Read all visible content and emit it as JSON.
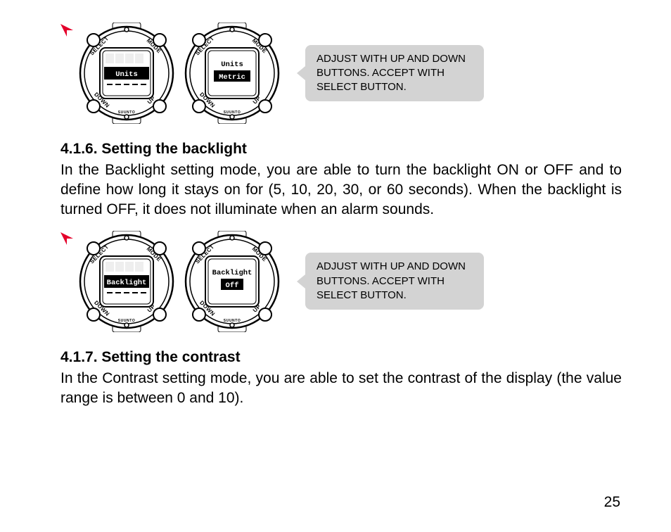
{
  "watch": {
    "buttons": {
      "tl": "SELECT",
      "tr": "MODE",
      "bl": "DOWN",
      "br": "UP"
    },
    "brand": "SUUNTO"
  },
  "figures": {
    "units": {
      "watch1": {
        "line1": "Units"
      },
      "watch2": {
        "line1": "Units",
        "line2": "Metric"
      },
      "callout": "ADJUST WITH UP AND DOWN BUTTONS. ACCEPT WITH SELECT BUTTON."
    },
    "backlight": {
      "watch1": {
        "line1": "Backlight"
      },
      "watch2": {
        "line1": "Backlight",
        "line2": "Off"
      },
      "callout": "ADJUST WITH UP AND DOWN BUTTONS. ACCEPT WITH SELECT BUTTON."
    }
  },
  "sections": {
    "s416": {
      "heading": "4.1.6. Setting the backlight",
      "body": "In the Backlight setting mode, you are able to turn the backlight ON or OFF and to define how long it stays on for (5, 10, 20, 30, or 60 seconds). When the backlight is turned OFF, it does not illuminate when an alarm sounds."
    },
    "s417": {
      "heading": "4.1.7. Setting the contrast",
      "body": "In the Contrast setting mode, you are able to set the contrast of the display (the value range is between 0 and 10)."
    }
  },
  "page_number": "25"
}
